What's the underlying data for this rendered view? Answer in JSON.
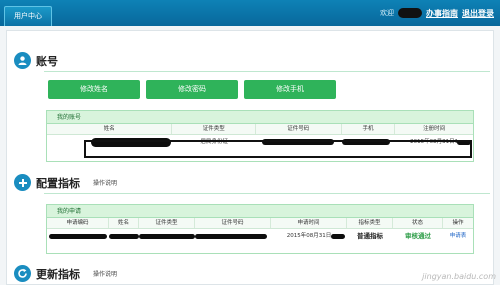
{
  "topbar": {
    "tab_label": "用户中心",
    "welcome": "欢迎",
    "guide_link": "办事指南",
    "logout_link": "退出登录"
  },
  "account": {
    "icon": "user-icon",
    "title": "账号",
    "buttons": [
      "修改姓名",
      "修改密码",
      "修改手机"
    ],
    "box_title": "我的账号",
    "columns": [
      "姓名",
      "证件类型",
      "证件号码",
      "手机",
      "注册时间"
    ],
    "row": {
      "id_type": "居民身份证",
      "register_time": "2015年08月31日1"
    }
  },
  "config": {
    "icon": "plus-icon",
    "title": "配置指标",
    "subtitle": "操作说明",
    "box_title": "我的申请",
    "columns": [
      "申请编码",
      "姓名",
      "证件类型",
      "证件号码",
      "申请时间",
      "指标类型",
      "状态",
      "操作"
    ],
    "row": {
      "apply_time": "2015年08月31日",
      "quota_type": "普通指标",
      "status": "审核通过",
      "action": "申请表"
    }
  },
  "update": {
    "icon": "refresh-icon",
    "title": "更新指标",
    "subtitle": "操作说明"
  },
  "watermark": "jingyan.baidu.com",
  "colors": {
    "topbar": "#0a74a8",
    "button": "#2fb35a",
    "box_border": "#a9e0b8",
    "box_title_bg": "#d8f4dc",
    "icon": "#1a8dc0"
  }
}
